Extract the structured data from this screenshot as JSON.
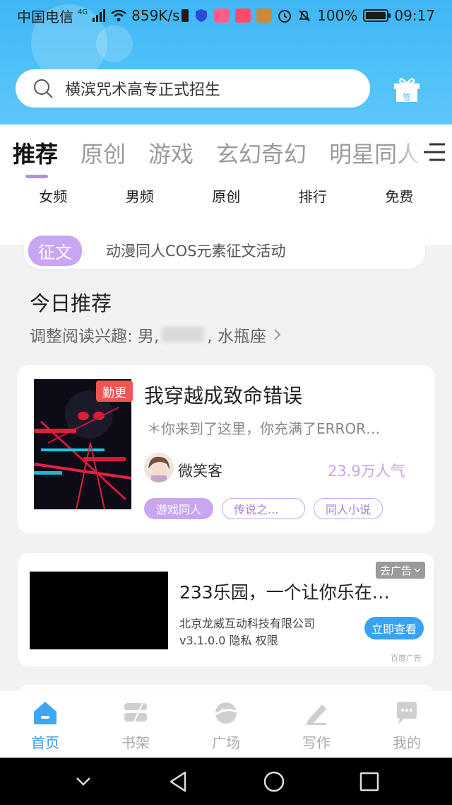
{
  "status_bar": {
    "carrier": "中国电信",
    "network": "4G",
    "speed": "859K/s",
    "battery": "100%",
    "time": "09:17"
  },
  "search": {
    "text": "横滨咒术高专正式招生"
  },
  "gift_icon_label": "签",
  "tabs": [
    {
      "label": "推荐",
      "active": true
    },
    {
      "label": "原创"
    },
    {
      "label": "游戏"
    },
    {
      "label": "玄幻奇幻"
    },
    {
      "label": "明星同人"
    }
  ],
  "subtabs": [
    "女频",
    "男频",
    "原创",
    "排行",
    "免费"
  ],
  "notice": {
    "badge": "征文",
    "text": "动漫同人COS元素征文活动"
  },
  "section": {
    "title": "今日推荐",
    "interest_prefix": "调整阅读兴趣: 男,",
    "interest_suffix": ", 水瓶座"
  },
  "book": {
    "badge": "勤更",
    "title": "我穿越成致命错误",
    "description": "＊你来到了这里，你充满了ERROR…",
    "author": "微笑客",
    "popularity": "23.9万人气",
    "tags": [
      "游戏同人",
      "传说之...",
      "同人小说"
    ]
  },
  "ad": {
    "title": "233乐园，一个让你乐在…",
    "company": "北京龙威互动科技有限公司",
    "meta": "v3.1.0.0  隐私  权限",
    "close_label": "去广告",
    "cta": "立即查看",
    "source": "百度广告"
  },
  "bottom_nav": [
    {
      "label": "首页",
      "icon": "home-icon",
      "active": true
    },
    {
      "label": "书架",
      "icon": "bookshelf-icon"
    },
    {
      "label": "广场",
      "icon": "square-icon"
    },
    {
      "label": "写作",
      "icon": "pen-icon"
    },
    {
      "label": "我的",
      "icon": "chat-icon"
    }
  ],
  "colors": {
    "header_blue": "#3fb7f4",
    "accent_purple": "#c8a6f2",
    "active_nav_blue": "#2f9bf0",
    "badge_red": "#ee5656"
  }
}
